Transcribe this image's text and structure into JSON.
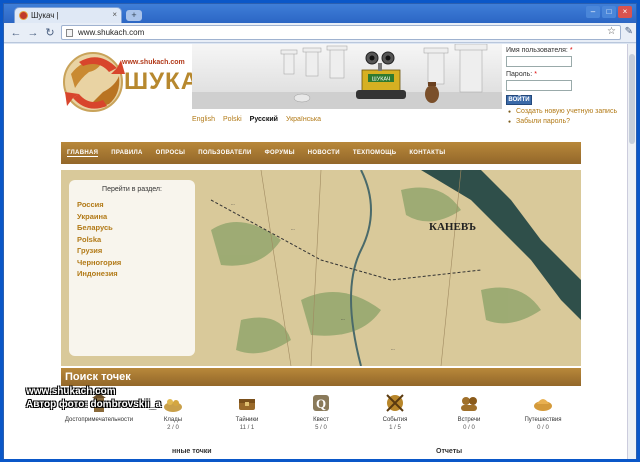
{
  "browser": {
    "tab_title": "Шукач |",
    "new_tab": "+",
    "url": "www.shukach.com"
  },
  "site": {
    "logo_url": "www.shukach.com",
    "logo_title": "ШУКАЧ",
    "robot_sign": "ШУКАЧ",
    "languages": [
      {
        "label": "English",
        "active": false
      },
      {
        "label": "Polski",
        "active": false
      },
      {
        "label": "Русский",
        "active": true
      },
      {
        "label": "Українська",
        "active": false
      }
    ]
  },
  "login": {
    "username_label": "Имя пользователя:",
    "password_label": "Пароль:",
    "required_mark": "*",
    "submit_label": "ВОЙТИ",
    "create_account": "Создать новую учетную запись",
    "forgot_password": "Забыли пароль?"
  },
  "nav": [
    "ГЛАВНАЯ",
    "ПРАВИЛА",
    "ОПРОСЫ",
    "ПОЛЬЗОВАТЕЛИ",
    "ФОРУМЫ",
    "НОВОСТИ",
    "ТЕХПОМОЩЬ",
    "КОНТАКТЫ"
  ],
  "map": {
    "panel_title": "Перейти в раздел:",
    "regions": [
      "Россия",
      "Украина",
      "Беларусь",
      "Polska",
      "Грузия",
      "Черногория",
      "Индонезия"
    ],
    "city_label": "КАНЕВЪ"
  },
  "points": {
    "title": "Поиск точек",
    "categories": [
      {
        "label": "Достопримечательности",
        "count": ""
      },
      {
        "label": "Клады",
        "count": "2 / 0"
      },
      {
        "label": "Тайники",
        "count": "11 / 1"
      },
      {
        "label": "Квест",
        "count": "5 / 0"
      },
      {
        "label": "События",
        "count": "1 / 5"
      },
      {
        "label": "Встречи",
        "count": "0 / 0"
      },
      {
        "label": "Путешествия",
        "count": "0 / 0"
      }
    ],
    "recent_label": "нные точки",
    "reports_label": "Отчеты"
  },
  "overlay": {
    "line1": "www.shukach.com",
    "line2": "Автор фото: dombrovskii_a"
  },
  "colors": {
    "accent": "#a57930",
    "link": "#b27a17",
    "chrome": "#0a57c8"
  }
}
